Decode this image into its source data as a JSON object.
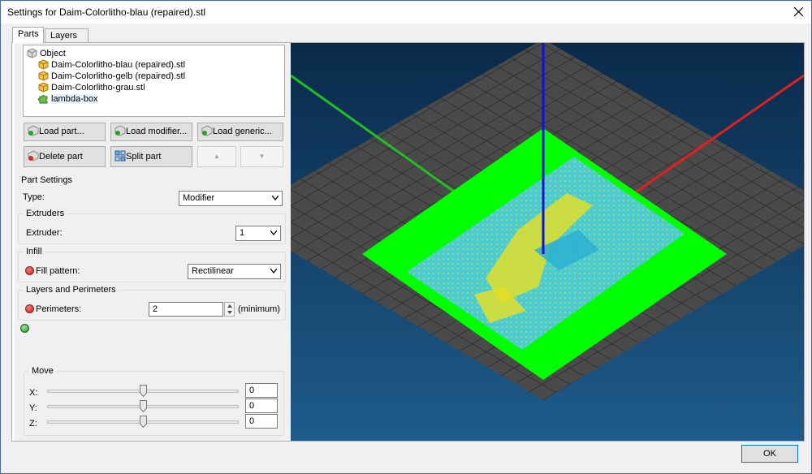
{
  "window": {
    "title": "Settings for Daim-Colorlitho-blau (repaired).stl"
  },
  "tabs": [
    {
      "label": "Parts",
      "active": true
    },
    {
      "label": "Layers",
      "active": false
    }
  ],
  "tree": {
    "root": "Object",
    "items": [
      {
        "label": "Daim-Colorlitho-blau (repaired).stl",
        "icon": "part-cube-icon"
      },
      {
        "label": "Daim-Colorlitho-gelb (repaired).stl",
        "icon": "part-cube-icon"
      },
      {
        "label": "Daim-Colorlitho-grau.stl",
        "icon": "part-cube-icon"
      },
      {
        "label": "lambda-box",
        "icon": "modifier-puzzle-icon"
      }
    ]
  },
  "buttons": {
    "load_part": "Load part...",
    "load_modifier": "Load modifier...",
    "load_generic": "Load generic...",
    "delete_part": "Delete part",
    "split_part": "Split part",
    "move_up": "▲",
    "move_down": "▼"
  },
  "part_settings": {
    "heading": "Part Settings",
    "type_label": "Type:",
    "type_value": "Modifier",
    "extruders_group": "Extruders",
    "extruder_label": "Extruder:",
    "extruder_value": "1",
    "infill_group": "Infill",
    "fill_pattern_label": "Fill pattern:",
    "fill_pattern_value": "Rectilinear",
    "layers_group": "Layers and Perimeters",
    "perimeters_label": "Perimeters:",
    "perimeters_value": "2",
    "perimeters_suffix": "(minimum)"
  },
  "move": {
    "heading": "Move",
    "x_label": "X:",
    "x_value": "0",
    "y_label": "Y:",
    "y_value": "0",
    "z_label": "Z:",
    "z_value": "0",
    "x_level": 0.5,
    "y_level": 0.5,
    "z_level": 0.5
  },
  "footer": {
    "ok_label": "OK"
  },
  "colors": {
    "viewport_bg_top": "#0a2a4a",
    "viewport_bg_bottom": "#1e5b8a",
    "bed_grid": "#4a4a4a",
    "modifier_box": "#00ff00",
    "axis_x": "#e02020",
    "axis_y": "#20c020",
    "axis_z": "#1010e0",
    "part_blue": "#4fc9e0",
    "part_yellow": "#e8e020"
  }
}
